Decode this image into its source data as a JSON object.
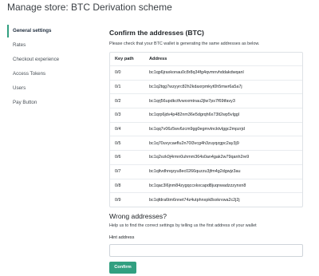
{
  "page": {
    "title": "Manage store: BTC Derivation scheme"
  },
  "sidebar": {
    "items": [
      {
        "label": "General settings",
        "active": true
      },
      {
        "label": "Rates",
        "active": false
      },
      {
        "label": "Checkout experience",
        "active": false
      },
      {
        "label": "Access Tokens",
        "active": false
      },
      {
        "label": "Users",
        "active": false
      },
      {
        "label": "Pay Button",
        "active": false
      }
    ]
  },
  "confirm_section": {
    "title": "Confirm the addresses (BTC)",
    "description": "Please check that your BTC wallet is generating the same addresses as below.",
    "table": {
      "columns": [
        "Key path",
        "Address"
      ],
      "rows": [
        {
          "key_path": "0/0",
          "address": "bc1qp6jraxkonau0c8r8q34fg4qvmnvhddakdwqanl"
        },
        {
          "key_path": "0/1",
          "address": "bc1q2tqg7wzyyrc82h2kdaxrpmkyt0h5mwr6a5a7j"
        },
        {
          "key_path": "0/2",
          "address": "bc1qrj56updkctfvwxxmtnau2jlw7ps7f69tfavy3"
        },
        {
          "key_path": "0/3",
          "address": "bc1qrp6jdv4p482nm36e5dgrqh6x73lt2wp5vlggl"
        },
        {
          "key_path": "0/4",
          "address": "bc1qq7v06z5wv6zcm9gg0egmvtncktvlggc2mpzrjd"
        },
        {
          "key_path": "0/5",
          "address": "bc1q70uvycaeflu2n70l3vcg4h3zuyqzgpc2ay3j9"
        },
        {
          "key_path": "0/6",
          "address": "bc1q2vzk0j4rmn0uhmm364s0an4gak2w79qanh2re9"
        },
        {
          "key_path": "0/7",
          "address": "bc1qltvdhnqzyu8ec0266quzzu3jfm4g2dgwjz3au"
        },
        {
          "key_path": "0/8",
          "address": "bc1qac3l6jnm84zygqccxkxcapd8juqnwadzzzynxn8"
        },
        {
          "key_path": "0/9",
          "address": "bc1qfdra6tm6nnet74z4utphnxpk8sxkrvwa2c2j2j"
        }
      ]
    }
  },
  "wrong_section": {
    "title": "Wrong addresses?",
    "help": "Help us to find the correct settings by telling us the first address of your wallet",
    "hint_label": "Hint address",
    "hint_value": "",
    "hint_placeholder": "",
    "confirm_label": "Confirm"
  },
  "colors": {
    "accent": "#329f80",
    "border": "#dee2e6",
    "text": "#212529"
  }
}
